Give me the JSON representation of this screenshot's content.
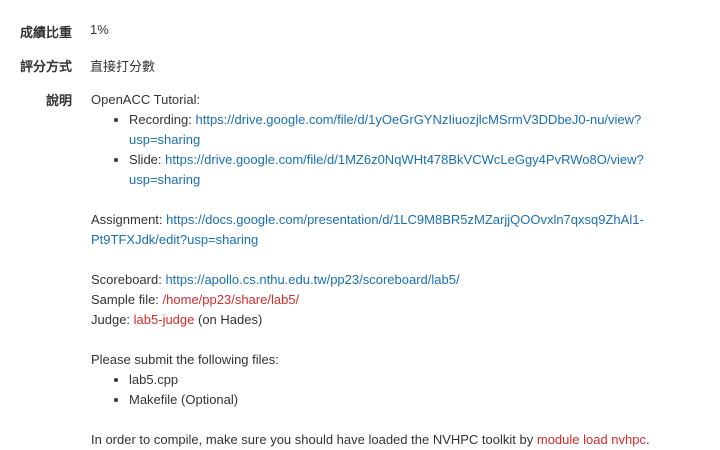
{
  "fields": {
    "weight_label": "成績比重",
    "weight_value": "1%",
    "grading_label": "評分方式",
    "grading_value": "直接打分數",
    "desc_label": "說明"
  },
  "description": {
    "tutorial_title": "OpenACC Tutorial:",
    "recording_label": "Recording: ",
    "recording_url": "https://drive.google.com/file/d/1yOeGrGYNzIiuozjlcMSrmV3DDbeJ0-nu/view?usp=sharing",
    "recording_url_line1": "https://drive.google.com/file/d/1yOeGrGYNzIiuozjlcMSrmV3DDbeJ0-nu/view?",
    "recording_url_line2": "usp=sharing",
    "slide_label": "Slide: ",
    "slide_url_line1": "https://drive.google.com/file/d/1MZ6z0NqWHt478BkVCWcLeGgy4PvRWo8O/view?",
    "slide_url_line2": "usp=sharing",
    "assignment_label": "Assignment: ",
    "assignment_url_line1": "https://docs.google.com/presentation/d/1LC9M8BR5zMZarjjQOOvxln7qxsq9ZhAl1-",
    "assignment_url_line2": "Pt9TFXJdk/edit?usp=sharing",
    "scoreboard_label": "Scoreboard: ",
    "scoreboard_url": "https://apollo.cs.nthu.edu.tw/pp23/scoreboard/lab5/",
    "sample_label": "Sample file: ",
    "sample_path": "/home/pp23/share/lab5/",
    "judge_label": "Judge: ",
    "judge_cmd": "lab5-judge",
    "judge_suffix": " (on Hades)",
    "submit_title": "Please submit the following files:",
    "files": [
      "lab5.cpp",
      "Makefile (Optional)"
    ],
    "compile_prefix": "In order to compile,  make sure you should have loaded the NVHPC toolkit by ",
    "compile_cmd": "module load nvhpc",
    "compile_suffix": "."
  },
  "colors": {
    "link": "#1a6fb5",
    "highlight": "#d62a2a",
    "text": "#333333"
  }
}
